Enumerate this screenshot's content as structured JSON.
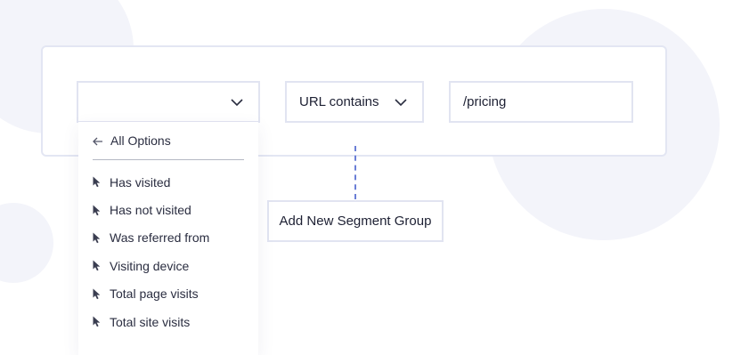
{
  "segment_row": {
    "condition_label": "URL contains",
    "value_text": "/pricing"
  },
  "add_group_label": "Add New Segment Group",
  "dropdown": {
    "back_label": "All Options",
    "items": [
      {
        "label": "Has visited"
      },
      {
        "label": "Has not visited"
      },
      {
        "label": "Was referred from"
      },
      {
        "label": "Visiting device"
      },
      {
        "label": "Total page visits"
      },
      {
        "label": "Total site visits"
      }
    ]
  },
  "icons": {
    "chevron": "chevron-down-icon",
    "back": "arrow-left-icon",
    "item": "cursor-pointer-icon"
  },
  "colors": {
    "border": "#e1e4f1",
    "connector": "#6b7fd6",
    "text": "#1d2033",
    "background_blob": "#f3f4fa"
  }
}
